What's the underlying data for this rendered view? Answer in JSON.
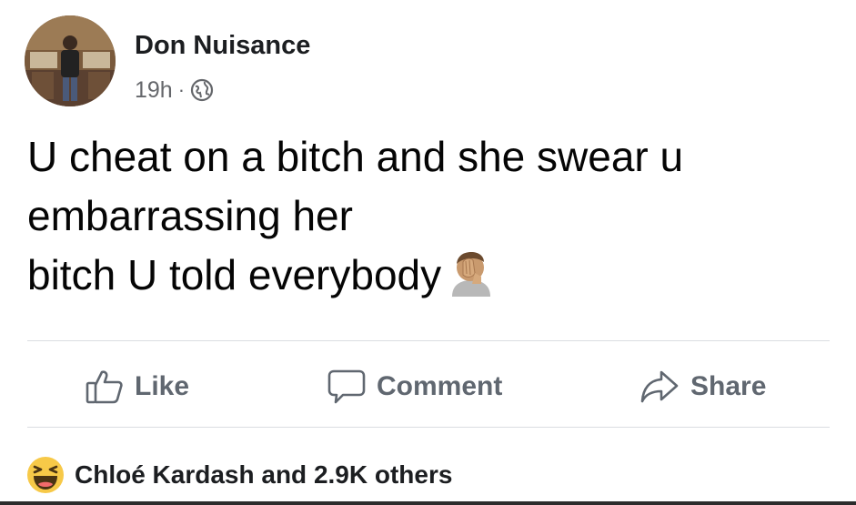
{
  "author": {
    "name": "Don Nuisance",
    "timestamp": "19h",
    "separator": "·",
    "privacy_icon": "globe-icon"
  },
  "post": {
    "lines": [
      "U cheat on a bitch and she swear u",
      "embarrassing her",
      "bitch U told everybody"
    ],
    "trailing_emoji": "face-palm-emoji"
  },
  "actions": {
    "like": "Like",
    "comment": "Comment",
    "share": "Share"
  },
  "reactions": {
    "icon": "haha-icon",
    "summary": "Chloé Kardash and 2.9K others"
  },
  "colors": {
    "text": "#050505",
    "muted": "#65676b",
    "action": "#606770",
    "divider": "#dadde1",
    "haha_yellow": "#f7c948"
  }
}
